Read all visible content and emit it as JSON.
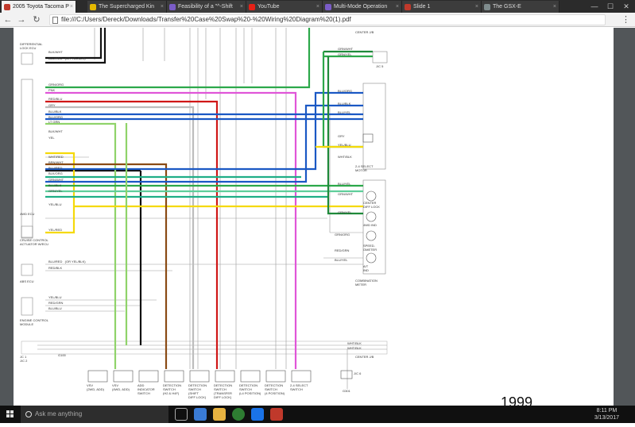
{
  "browser": {
    "tabs": [
      {
        "label": "2005 Toyota Tacoma P",
        "color": "#c0392b"
      },
      {
        "label": "The Supercharged Kin",
        "color": "#e5b800"
      },
      {
        "label": "Feasibility of a \"^-Shift",
        "color": "#7a5cc7"
      },
      {
        "label": "YouTube",
        "color": "#e62117"
      },
      {
        "label": "Multi-Mode Operation",
        "color": "#7a5cc7"
      },
      {
        "label": "Slide 1",
        "color": "#c0392b"
      },
      {
        "label": "The GSX-E",
        "color": "#7f8c8d"
      }
    ],
    "close_glyph": "×",
    "url": "file:///C:/Users/Dereck/Downloads/Transfer%20Case%20Swap%20-%20Wiring%20Diagram%20(1).pdf",
    "controls": {
      "back": "←",
      "forward": "→",
      "reload": "↻",
      "menu": "⋮",
      "minimize": "—",
      "maximize": "☐",
      "close": "✕"
    }
  },
  "diagram": {
    "year": "1999",
    "labels": {
      "center_jb_top": "CENTER J/B",
      "diff_lock_ecu": "DIFFERENTIAL\nLOCK ECU",
      "ecu_4wd": "4WD ECU",
      "cruise_control": "CRUISE CONTROL\nACTUATOR W/ECU",
      "abs_ecu": "ABS ECU",
      "engine_control": "ENGINE CONTROL\nMODULE",
      "select_motor": "2-4 SELECT\nMOTOR",
      "center_diff_lock": "CENTER\nDIFF LOCK",
      "ind_4wd": "4WD IND",
      "speedometer": "SPEED-\nOMETER",
      "att_ind": "A/T\nIND",
      "combination_meter": "COMBINATION\nMETER",
      "jc1": "JC 1\nJ/C 2",
      "jc5": "J/C 5",
      "jc6": "J/C 6",
      "g301": "G301",
      "g100": "G100",
      "center_jb_bottom": "CENTER J/B",
      "bottom_components": [
        "VSV\n(2WD, ADD)",
        "VSV\n(4WD, ADD)",
        "ADD\nINDICATOR\nSWITCH",
        "DETECTION\nSWITCH\n(H2 & H4F)",
        "DETECTION\nSWITCH\n(SHIFT\nDIFF LOCK)",
        "DETECTION\nSWITCH\n(TRANSFER\nDIFF LOCK)",
        "DETECTION\nSWITCH\n(L4 POSITION)",
        "DETECTION\nSWITCH\n(4 POSITION)",
        "2-4 SELECT\nSWITCH"
      ],
      "wire_tags_left": [
        "BLK/WHT",
        "BLU/RED   (OR YEL/BLK)",
        "GRN/ORG",
        "PNK",
        "RED/BLU",
        "GRY",
        "BLU/BLK",
        "BLU/ORG",
        "LT GRN",
        "BLK/WHT",
        "YEL",
        "WHT/RED",
        "BRN/WHT",
        "BLU/RED",
        "BLK/ORG",
        "GRN/WHT",
        "BLU/BLK",
        "GRN/YEL",
        "YEL/BLU",
        "YEL/RED",
        "BLU/RED   (OR YEL/BLK)",
        "RED/BLK",
        "YEL/BLU",
        "RED/GRN",
        "BLU/BLU"
      ],
      "wire_tags_right": [
        "GRN/WHT",
        "GRN/YEL",
        "BLU/ORG",
        "BLU/BLK",
        "BLU/YEL",
        "GRY",
        "YEL/BLU",
        "WHT/BLK",
        "BLU/YEL",
        "GRN/WHT",
        "GRN/YEL",
        "GRN/ORG",
        "RED/GRN",
        "BLU/YEL",
        "WHT/BLK",
        "WHT/BLK"
      ]
    }
  },
  "taskbar": {
    "search_placeholder": "Ask me anything",
    "time": "8:11 PM",
    "date": "3/13/2017"
  }
}
